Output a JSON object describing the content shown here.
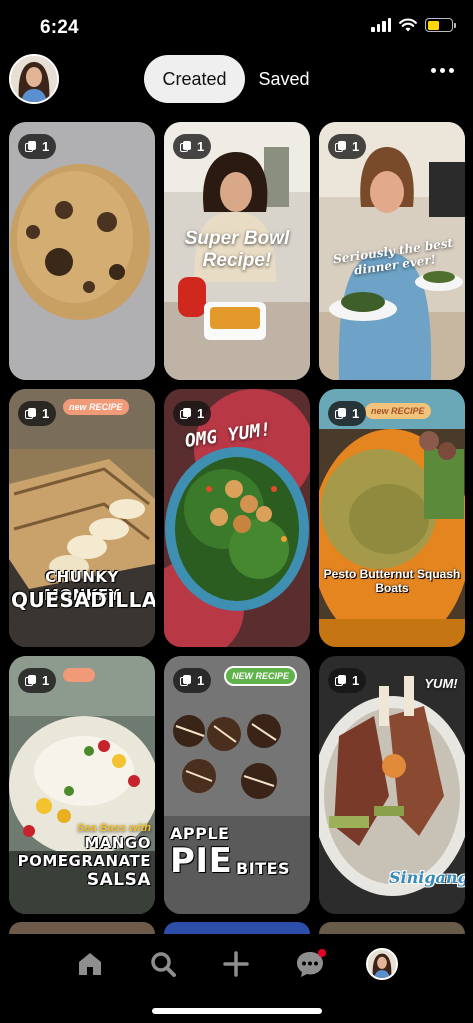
{
  "status_bar": {
    "time": "6:24"
  },
  "header": {
    "tabs": [
      {
        "label": "Created",
        "active": true
      },
      {
        "label": "Saved",
        "active": false
      }
    ]
  },
  "pins": [
    {
      "count": "1",
      "subject": "chocolate chip cookie",
      "overlay": ""
    },
    {
      "count": "1",
      "subject": "woman holding soup bowl",
      "overlay": "Super Bowl Recipe!"
    },
    {
      "count": "1",
      "subject": "woman holding dinner plate",
      "overlay": "Seriously the best dinner ever!"
    },
    {
      "count": "1",
      "subject": "quesadilla with bananas",
      "tag": "new RECIPE",
      "overlay_line1": "CHUNKY MONKEY",
      "overlay_line2": "QUESADILLA"
    },
    {
      "count": "1",
      "subject": "kale salad with shrimp",
      "overlay": "OMG YUM!"
    },
    {
      "count": "1",
      "subject": "butternut squash boats",
      "tag": "new RECIPE",
      "overlay": "Pesto Butternut Squash Boats"
    },
    {
      "count": "1",
      "subject": "sea bass with salsa",
      "overlay_line1": "Sea Bass with",
      "overlay_line2": "MANGO",
      "overlay_line3": "POMEGRANATE",
      "overlay_line4": "SALSA"
    },
    {
      "count": "1",
      "subject": "apple pie bites",
      "tag": "NEW RECIPE",
      "overlay_line1": "APPLE",
      "overlay_line2": "PIE",
      "overlay_line3": "BITES"
    },
    {
      "count": "1",
      "subject": "short ribs",
      "overlay": "YUM!",
      "overlay2": "Sinigang"
    }
  ],
  "bottom_nav": {
    "items": [
      "home-icon",
      "search-icon",
      "plus-icon",
      "chat-icon",
      "profile-avatar"
    ],
    "notification_color": "#e60023"
  },
  "colors": {
    "background": "#000000",
    "active_tab_bg": "#efefef"
  }
}
